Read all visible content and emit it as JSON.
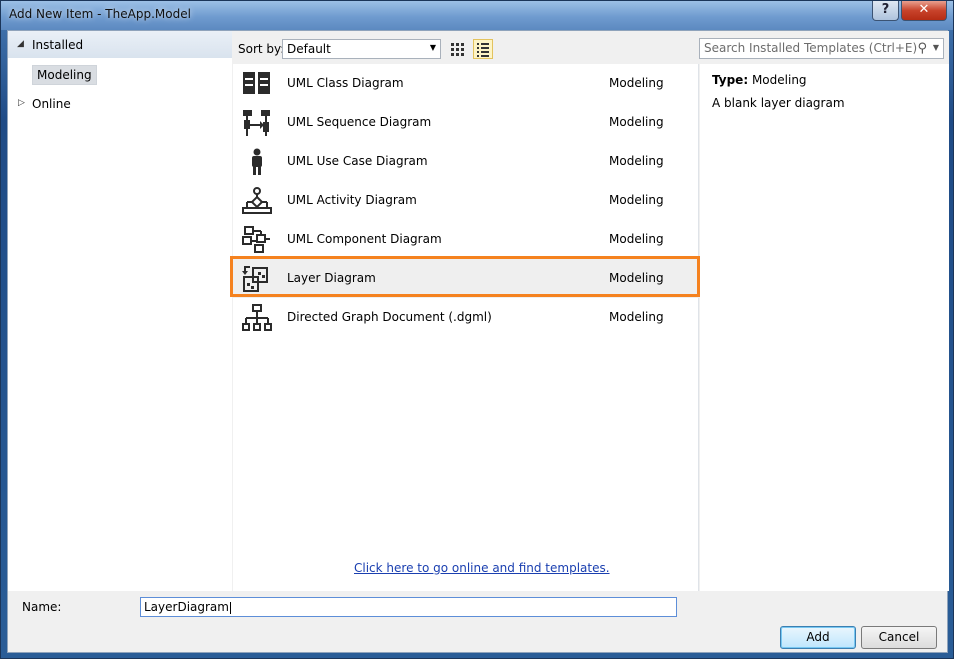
{
  "window": {
    "title": "Add New Item - TheApp.Model",
    "help_label": "?",
    "close_label": "✕"
  },
  "tree": {
    "installed_label": "Installed",
    "modeling_label": "Modeling",
    "online_label": "Online"
  },
  "toolbar": {
    "sort_label": "Sort by:",
    "sort_value": "Default",
    "search_placeholder": "Search Installed Templates (Ctrl+E)"
  },
  "templates": [
    {
      "name": "UML Class Diagram",
      "category": "Modeling",
      "icon": "uml-class-icon"
    },
    {
      "name": "UML Sequence Diagram",
      "category": "Modeling",
      "icon": "uml-sequence-icon"
    },
    {
      "name": "UML Use Case Diagram",
      "category": "Modeling",
      "icon": "uml-use-case-icon"
    },
    {
      "name": "UML Activity Diagram",
      "category": "Modeling",
      "icon": "uml-activity-icon"
    },
    {
      "name": "UML Component Diagram",
      "category": "Modeling",
      "icon": "uml-component-icon"
    },
    {
      "name": "Layer Diagram",
      "category": "Modeling",
      "icon": "layer-diagram-icon",
      "selected": true
    },
    {
      "name": "Directed Graph Document (.dgml)",
      "category": "Modeling",
      "icon": "directed-graph-icon"
    }
  ],
  "online_link": "Click here to go online and find templates.",
  "description": {
    "type_label": "Type:",
    "type_value": "Modeling",
    "text": "A blank layer diagram"
  },
  "footer": {
    "name_label": "Name:",
    "name_value": "LayerDiagram",
    "add_label": "Add",
    "cancel_label": "Cancel"
  },
  "colors": {
    "selection_frame": "#f5821f",
    "link": "#1a3fb0"
  }
}
